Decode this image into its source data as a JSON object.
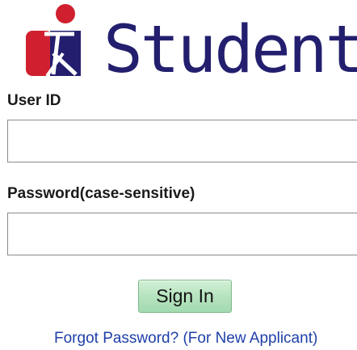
{
  "logo": {
    "text": "Student",
    "icon": "istudent-person-icon",
    "colors": {
      "red": "#d0202f",
      "navy": "#231f6e"
    }
  },
  "form": {
    "userid_label": "User ID",
    "userid_value": "",
    "password_label": "Password(case-sensitive)",
    "password_value": "",
    "signin_label": "Sign In"
  },
  "links": {
    "forgot_password": "Forgot Password? (For New Applicant)"
  },
  "colors": {
    "button_green": "#b6e3bf",
    "link_blue": "#1f3fa8"
  }
}
